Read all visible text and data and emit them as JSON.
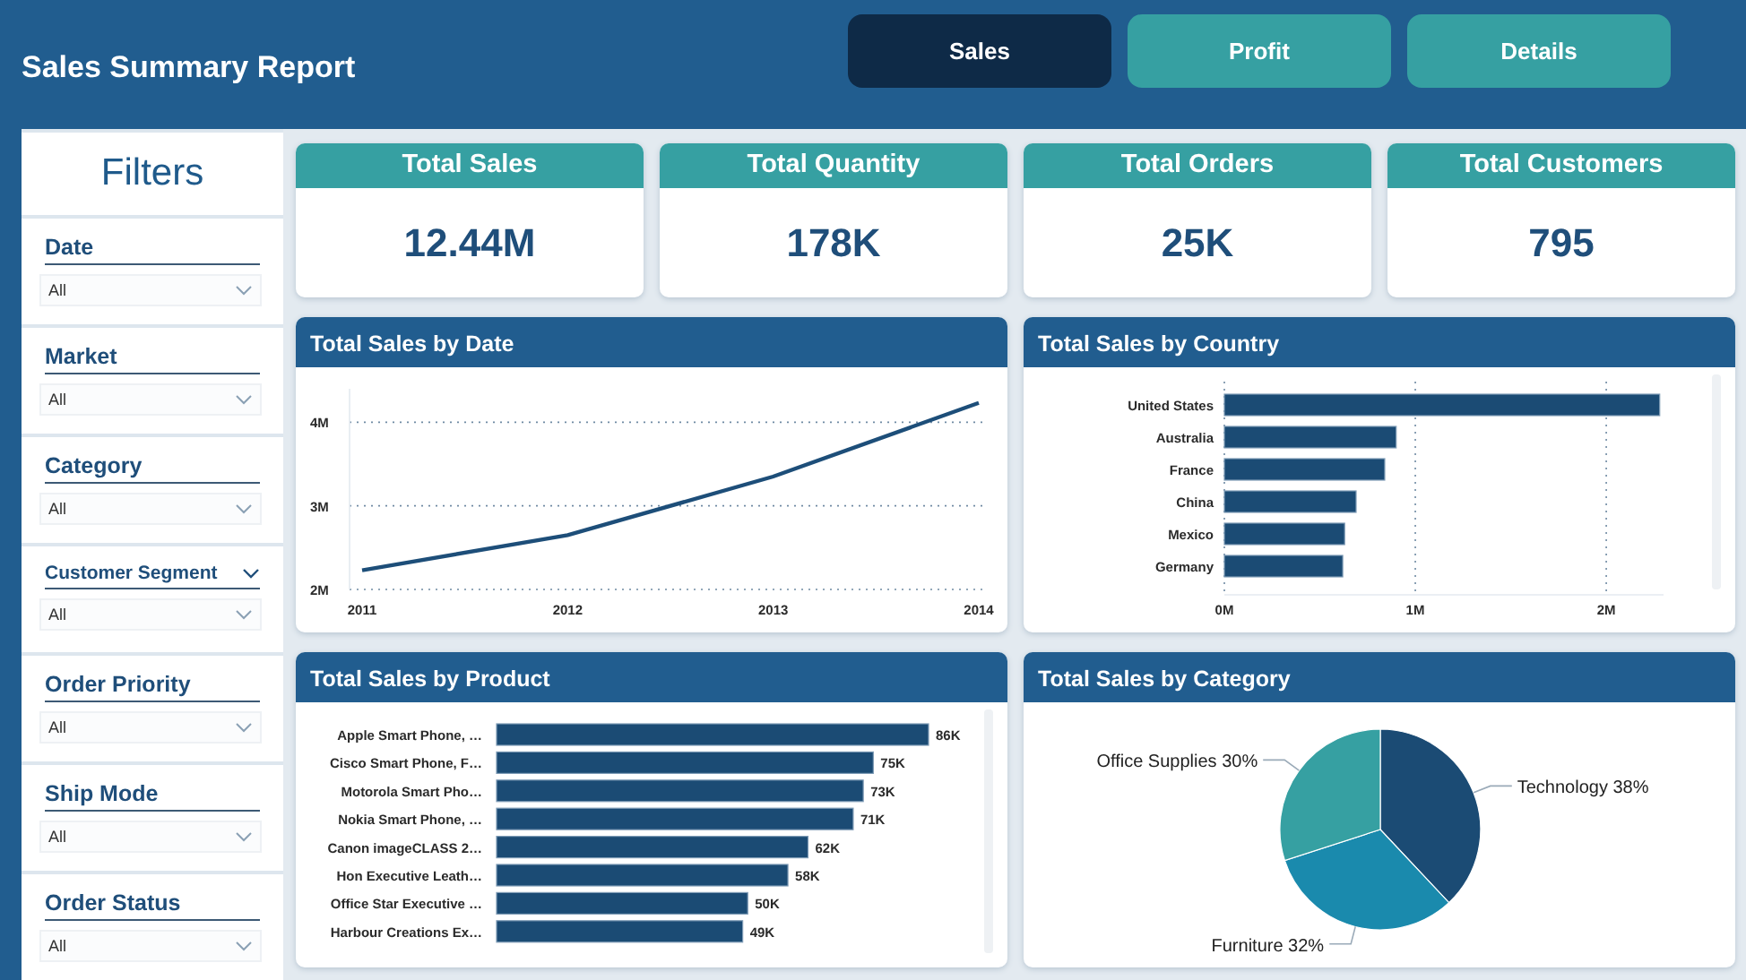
{
  "header": {
    "title": "Sales Summary Report"
  },
  "tabs": [
    {
      "label": "Sales",
      "selected": true
    },
    {
      "label": "Profit",
      "selected": false
    },
    {
      "label": "Details",
      "selected": false
    }
  ],
  "filters": {
    "title": "Filters",
    "items": [
      {
        "label": "Date",
        "value": "All",
        "kind": "plain"
      },
      {
        "label": "Market",
        "value": "All",
        "kind": "plain"
      },
      {
        "label": "Category",
        "value": "All",
        "kind": "plain"
      },
      {
        "label": "Customer Segment",
        "value": "All",
        "kind": "toggle"
      },
      {
        "label": "Order Priority",
        "value": "All",
        "kind": "plain"
      },
      {
        "label": "Ship Mode",
        "value": "All",
        "kind": "plain"
      },
      {
        "label": "Order Status",
        "value": "All",
        "kind": "plain"
      }
    ]
  },
  "kpis": [
    {
      "title": "Total Sales",
      "value": "12.44M"
    },
    {
      "title": "Total Quantity",
      "value": "178K"
    },
    {
      "title": "Total Orders",
      "value": "25K"
    },
    {
      "title": "Total Customers",
      "value": "795"
    }
  ],
  "sales_by_date": {
    "title": "Total Sales by Date",
    "chart_data": {
      "type": "line",
      "categories": [
        "2011",
        "2012",
        "2013",
        "2014"
      ],
      "series": [
        {
          "color": "#1d4e79",
          "values": [
            2.23,
            2.65,
            3.35,
            4.23
          ]
        }
      ],
      "ylim": [
        2,
        4.4
      ],
      "yticks": [
        {
          "value": 2,
          "label": "2M"
        },
        {
          "value": 3,
          "label": "3M"
        },
        {
          "value": 4,
          "label": "4M"
        }
      ]
    }
  },
  "sales_by_country": {
    "title": "Total Sales by Country",
    "chart_data": {
      "type": "bar",
      "orientation": "horizontal",
      "categories": [
        "United States",
        "Australia",
        "France",
        "China",
        "Mexico",
        "Germany"
      ],
      "values": [
        2.28,
        0.9,
        0.84,
        0.69,
        0.63,
        0.62
      ],
      "xlim": [
        0,
        2.3
      ],
      "xticks": [
        {
          "value": 0,
          "label": "0M"
        },
        {
          "value": 1,
          "label": "1M"
        },
        {
          "value": 2,
          "label": "2M"
        }
      ]
    }
  },
  "sales_by_product": {
    "title": "Total Sales by Product",
    "chart_data": {
      "type": "bar",
      "orientation": "horizontal",
      "categories": [
        "Apple Smart Phone, …",
        "Cisco Smart Phone, F…",
        "Motorola Smart Pho…",
        "Nokia Smart Phone, …",
        "Canon imageCLASS 2…",
        "Hon Executive Leath…",
        "Office Star Executive …",
        "Harbour Creations Ex…"
      ],
      "values": [
        86,
        75,
        73,
        71,
        62,
        58,
        50,
        49
      ],
      "value_labels": [
        "86K",
        "75K",
        "73K",
        "71K",
        "62K",
        "58K",
        "50K",
        "49K"
      ]
    }
  },
  "sales_by_category": {
    "title": "Total Sales by Category",
    "chart_data": {
      "type": "pie",
      "values": [
        38,
        32,
        30
      ],
      "colors": [
        "#1b4b74",
        "#1a8aad",
        "#36a0a2"
      ],
      "value_labels": [
        "Technology 38%",
        "Furniture 32%",
        "Office Supplies 30%"
      ]
    }
  }
}
